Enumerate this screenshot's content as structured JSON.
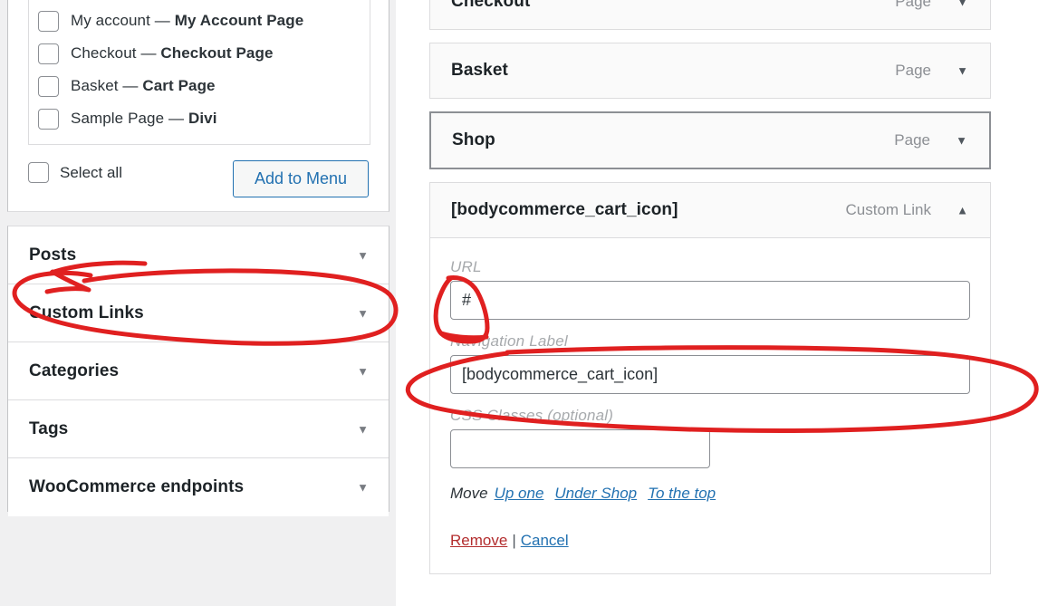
{
  "left_panel": {
    "page_checklist": {
      "items": [
        {
          "label": "My account",
          "dash": "—",
          "page": "My Account Page",
          "checked": false
        },
        {
          "label": "Checkout",
          "dash": "—",
          "page": "Checkout Page",
          "checked": false
        },
        {
          "label": "Basket",
          "dash": "—",
          "page": "Cart Page",
          "checked": false
        },
        {
          "label": "Sample Page",
          "dash": "—",
          "page": "Divi",
          "checked": false
        }
      ]
    },
    "select_all_label": "Select all",
    "select_all_checked": false,
    "add_to_menu_label": "Add to Menu",
    "accordion": [
      {
        "label": "Posts",
        "caret": "▼",
        "expanded": false
      },
      {
        "label": "Custom Links",
        "caret": "▼",
        "expanded": false
      },
      {
        "label": "Categories",
        "caret": "▼",
        "expanded": false
      },
      {
        "label": "Tags",
        "caret": "▼",
        "expanded": false
      },
      {
        "label": "WooCommerce endpoints",
        "caret": "▼",
        "expanded": false
      }
    ]
  },
  "menu_structure": {
    "items": [
      {
        "title": "Checkout",
        "type": "Page",
        "caret": "▼",
        "expanded": false,
        "focused": false
      },
      {
        "title": "Basket",
        "type": "Page",
        "caret": "▼",
        "expanded": false,
        "focused": false
      },
      {
        "title": "Shop",
        "type": "Page",
        "caret": "▼",
        "expanded": false,
        "focused": true
      },
      {
        "title": "[bodycommerce_cart_icon]",
        "type": "Custom Link",
        "caret": "▲",
        "expanded": true,
        "focused": false
      }
    ],
    "expanded_item": {
      "url_label": "URL",
      "url_value": "#",
      "nav_label_label": "Navigation Label",
      "nav_label_value": "[bodycommerce_cart_icon]",
      "css_classes_label": "CSS Classes (optional)",
      "css_classes_value": "",
      "move": {
        "prefix": "Move",
        "links": [
          "Up one",
          "Under Shop",
          "To the top"
        ]
      },
      "actions": {
        "remove": "Remove",
        "separator": "|",
        "cancel": "Cancel"
      }
    }
  },
  "annotations": {
    "color": "#e02020",
    "marks": [
      {
        "name": "custom-links-circle",
        "target": "Custom Links"
      },
      {
        "name": "url-field-circle",
        "target": "# URL field"
      },
      {
        "name": "navigation-label-circle",
        "target": "Navigation Label field"
      }
    ]
  },
  "colors": {
    "accent_blue": "#2271b1",
    "remove_red": "#b32d2e",
    "annotation_red": "#e02020",
    "panel_bg": "#f0f0f1",
    "item_bg": "#fafafa",
    "border": "#dcdcde"
  }
}
